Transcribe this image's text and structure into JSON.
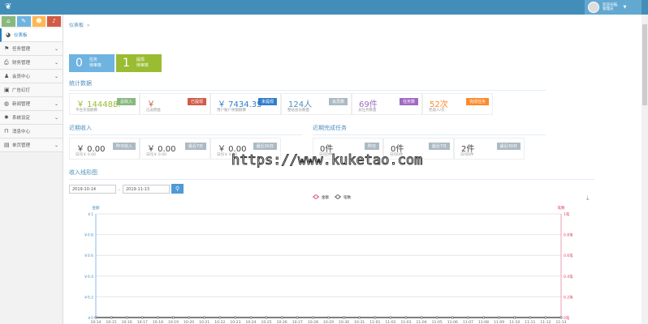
{
  "header": {
    "logo_icon": "leaf-icon",
    "welcome": "欢迎光临,",
    "user": "管理员"
  },
  "sidebar": {
    "shortcuts": [
      {
        "icon": "home-icon",
        "color": "#87b87f"
      },
      {
        "icon": "pencil-icon",
        "color": "#6fb3e0"
      },
      {
        "icon": "users-icon",
        "color": "#ffb752"
      },
      {
        "icon": "bell-icon",
        "color": "#d15b47"
      }
    ],
    "items": [
      {
        "label": "仪表板",
        "icon": "dashboard-icon",
        "active": true
      },
      {
        "label": "任务管理",
        "icon": "flag-icon",
        "sub": true
      },
      {
        "label": "财务管理",
        "icon": "print-icon",
        "sub": true
      },
      {
        "label": "会员中心",
        "icon": "user-icon",
        "sub": true
      },
      {
        "label": "广告幻灯",
        "icon": "picture-icon",
        "sub": false
      },
      {
        "label": "新闻管理",
        "icon": "globe-icon",
        "sub": true
      },
      {
        "label": "系统设定",
        "icon": "cog-icon",
        "sub": true
      },
      {
        "label": "消息中心",
        "icon": "bookmark-icon",
        "sub": false
      },
      {
        "label": "单页管理",
        "icon": "book-icon",
        "sub": true
      }
    ]
  },
  "breadcrumb": {
    "item": "仪表板",
    "sep": "»"
  },
  "pending": [
    {
      "num": "0",
      "title": "任务",
      "sub": "待审核",
      "color": "#6fb3e0"
    },
    {
      "num": "1",
      "title": "提现",
      "sub": "待审核",
      "color": "#9abc32"
    }
  ],
  "stats": {
    "title": "统计数据",
    "cards": [
      {
        "value": "￥ 144488.",
        "desc": "平台充值额算",
        "badge": "总收入",
        "color": "#87b87f",
        "vcolor": "#9abc32"
      },
      {
        "value": "￥",
        "desc": "已返佣金",
        "badge": "已提现",
        "color": "#d15b47",
        "vcolor": "#d15b47"
      },
      {
        "value": "￥ 7434.35",
        "desc": "用户账户余额额算",
        "badge": "未提现",
        "color": "#307ecc",
        "vcolor": "#307ecc"
      },
      {
        "value": "124人",
        "desc": "整站会员数量",
        "badge": "会员数",
        "color": "#abbac3",
        "vcolor": "#4c8fbd"
      },
      {
        "value": "69件",
        "desc": "总任务数量",
        "badge": "任务数",
        "color": "#a069c3",
        "vcolor": "#a069c3"
      },
      {
        "value": "52次",
        "desc": "完成人/次",
        "badge": "完成任务",
        "color": "#ff892a",
        "vcolor": "#ff892a"
      }
    ]
  },
  "income": {
    "title": "近期收入",
    "cards": [
      {
        "value": "￥ 0.00",
        "desc": "日均￥ 0.00",
        "badge": "昨日收入"
      },
      {
        "value": "￥ 0.00",
        "desc": "日均￥ 0.00",
        "badge": "最近7日"
      },
      {
        "value": "￥ 0.00",
        "desc": "日均￥ 0.00",
        "badge": "最近30日"
      }
    ]
  },
  "tasks": {
    "title": "近期完成任务",
    "cards": [
      {
        "value": "0件",
        "desc": "日均0件",
        "badge": "昨日"
      },
      {
        "value": "0件",
        "desc": "日均0件",
        "badge": "最近7日"
      },
      {
        "value": "2件",
        "desc": "日均0件",
        "badge": "最近30日"
      }
    ]
  },
  "watermark": "https://www.kuketao.com",
  "linechart": {
    "title": "收入线形图",
    "date_from": "2019-10-14",
    "sep": "..",
    "date_to": "2019-11-13",
    "search_icon": "search-icon",
    "download_icon": "download-icon"
  },
  "chart_data": {
    "type": "line",
    "categories": [
      "10-14",
      "10-15",
      "10-16",
      "10-17",
      "10-18",
      "10-19",
      "10-20",
      "10-21",
      "10-22",
      "10-23",
      "10-24",
      "10-25",
      "10-26",
      "10-27",
      "10-28",
      "10-29",
      "10-30",
      "10-31",
      "11-01",
      "11-02",
      "11-03",
      "11-04",
      "11-05",
      "11-06",
      "11-07",
      "11-08",
      "11-09",
      "11-10",
      "11-11",
      "11-12",
      "11-13"
    ],
    "series": [
      {
        "name": "金额",
        "values": [
          0,
          0,
          0,
          0,
          0,
          0,
          0,
          0,
          0,
          0,
          0,
          0,
          0,
          0,
          0,
          0,
          0,
          0,
          0,
          0,
          0,
          0,
          0,
          0,
          0,
          0,
          0,
          0,
          0,
          0,
          0
        ],
        "color": "#e0416a"
      },
      {
        "name": "笔数",
        "values": [
          0,
          0,
          0,
          0,
          0,
          0,
          0,
          0,
          0,
          0,
          0,
          0,
          0,
          0,
          0,
          0,
          0,
          0,
          0,
          0,
          0,
          0,
          0,
          0,
          0,
          0,
          0,
          0,
          0,
          0,
          0
        ],
        "color": "#555555"
      }
    ],
    "ylabel_left": "金额",
    "ylabel_right": "笔数",
    "yticks_left": [
      "￥0",
      "￥0.2",
      "￥0.4",
      "￥0.6",
      "￥0.8",
      "￥1"
    ],
    "yticks_right": [
      "0笔",
      "0.2笔",
      "0.4笔",
      "0.6笔",
      "0.8笔",
      "1笔"
    ],
    "ylim": [
      0,
      1
    ],
    "legend": "top-center",
    "grid": true
  }
}
